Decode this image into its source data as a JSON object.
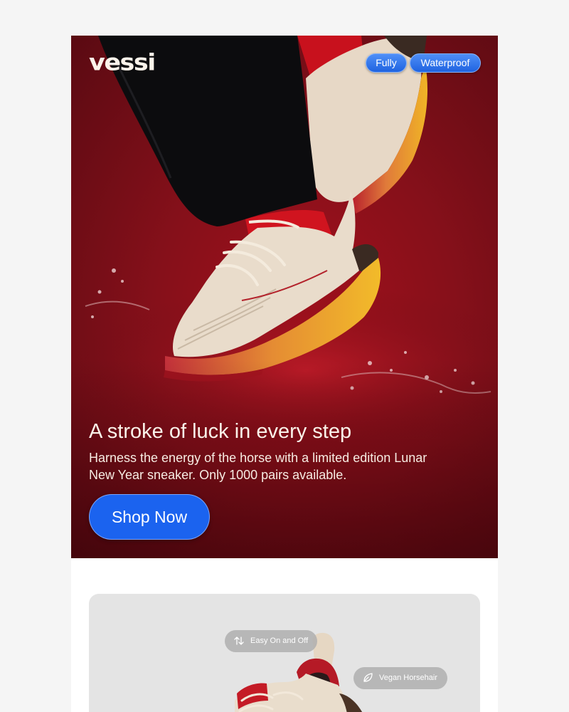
{
  "hero": {
    "logo": "vessi",
    "badges": [
      "Fully",
      "Waterproof"
    ],
    "headline": "A stroke of luck in every step",
    "body": "Harness the energy of the horse with a limited edition Lunar New Year sneaker. Only 1000 pairs available.",
    "cta_label": "Shop Now"
  },
  "feature_card": {
    "features": [
      {
        "label": "Easy On and Off",
        "icon": "arrows-up-down-icon"
      },
      {
        "label": "Vegan Horsehair",
        "icon": "leaf-icon"
      }
    ]
  },
  "colors": {
    "page_background": "#f5f5f5",
    "hero_red": "#86101a",
    "cta_blue": "#1b63ef",
    "sole_yellow": "#e8a91f",
    "card_gray": "#e4e4e4"
  }
}
